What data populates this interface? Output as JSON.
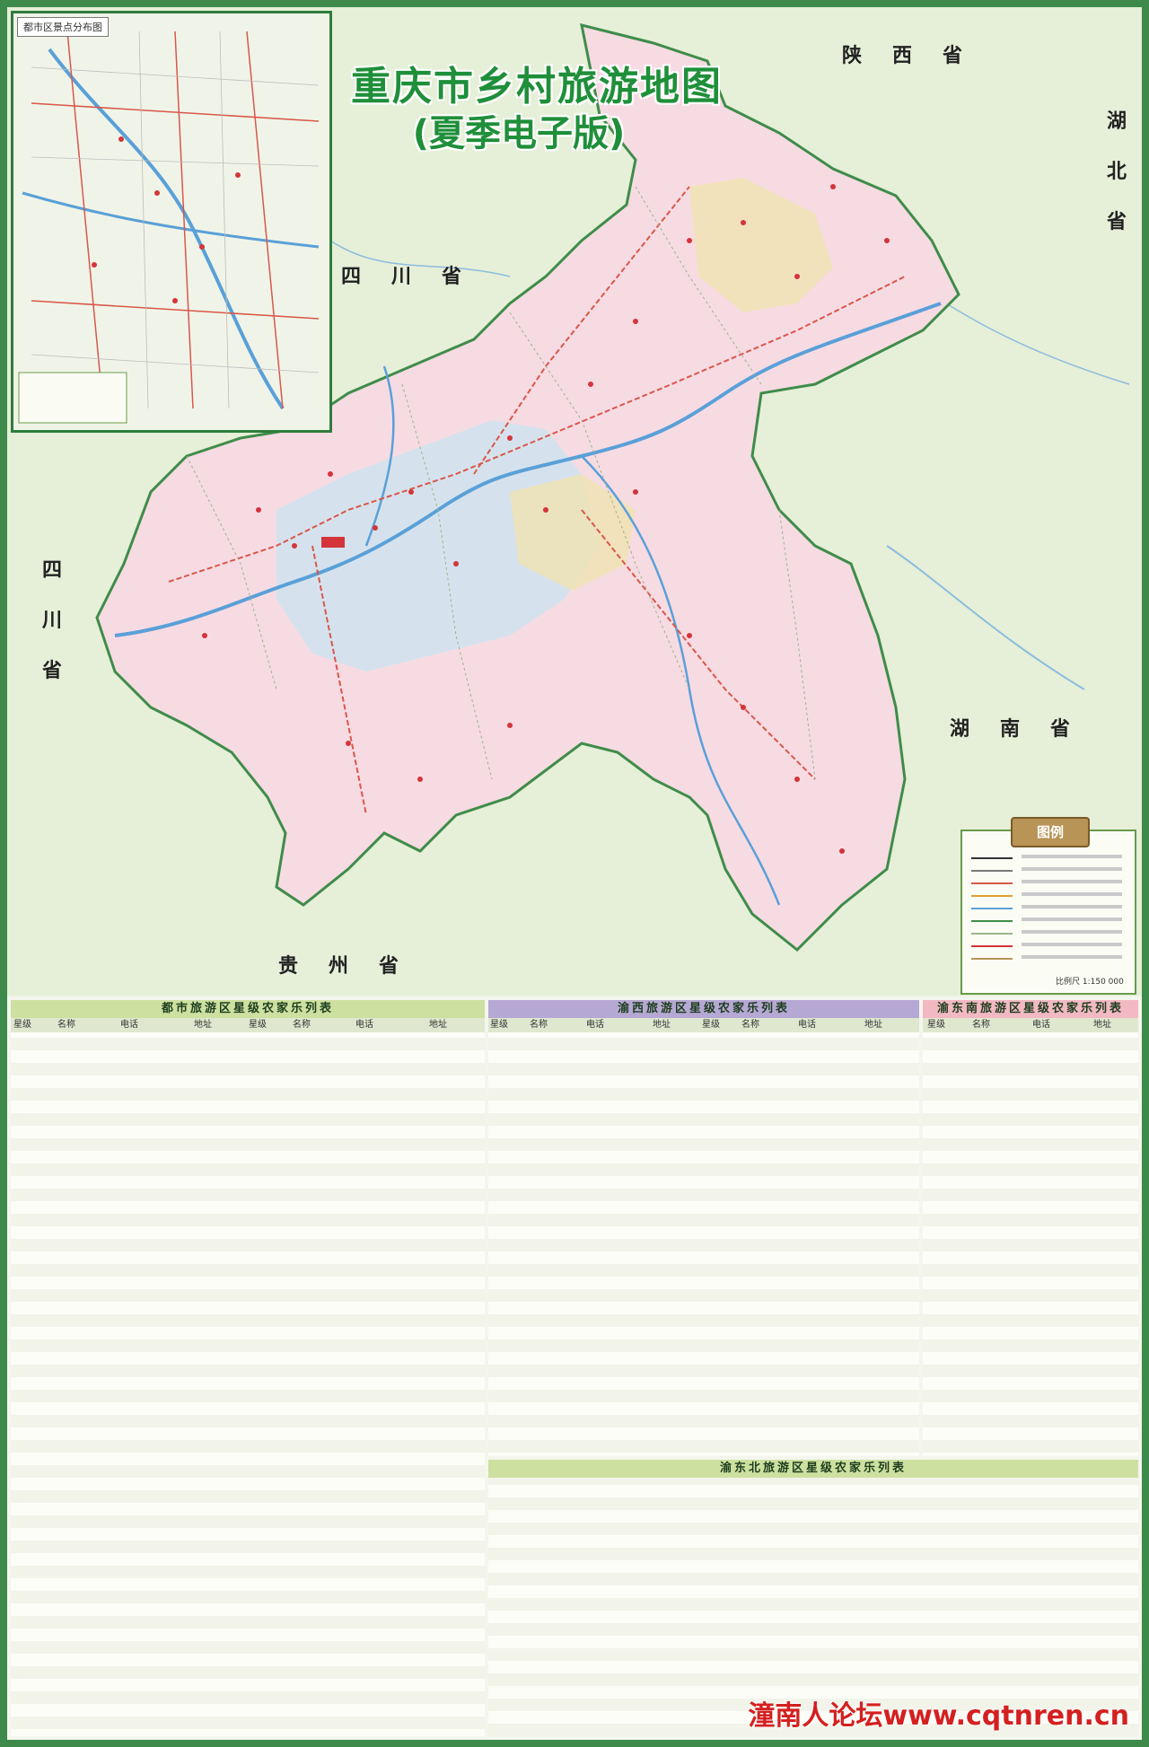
{
  "map": {
    "title": "重庆市乡村旅游地图",
    "subtitle": "(夏季电子版)",
    "inset_title": "都市区景点分布图",
    "provinces": {
      "shaanxi": "陕西省",
      "hubei": "湖北省",
      "sichuan_north": "四川省",
      "sichuan_west": "四川省",
      "hunan": "湖南省",
      "guizhou": "贵州省"
    },
    "legend_title": "图例",
    "scale": "比例尺 1:150 000",
    "region_colors": {
      "chongqing_fill": "#f7dbe3",
      "central_fill": "#cfe3ef",
      "yellow_fill": "#efe3b0",
      "outside_fill": "#e6efd8",
      "border": "#3f8c4a",
      "river": "#5aa0d8",
      "road": "#d9574a"
    }
  },
  "tables": {
    "urban": {
      "title": "都市旅游区星级农家乐列表",
      "headers": [
        "星级",
        "名称",
        "电话",
        "地址",
        "星级",
        "名称",
        "电话",
        "地址"
      ],
      "color": "#cde0a0"
    },
    "yuxi": {
      "title": "渝西旅游区星级农家乐列表",
      "headers": [
        "星级",
        "名称",
        "电话",
        "地址",
        "星级",
        "名称",
        "电话",
        "地址"
      ],
      "color": "#b6a8d4"
    },
    "yudongnan": {
      "title": "渝东南旅游区星级农家乐列表",
      "headers": [
        "星级",
        "名称",
        "电话",
        "地址"
      ],
      "color": "#f2b9c3"
    },
    "yudongbei": {
      "title": "渝东北旅游区星级农家乐列表",
      "color": "#cde0a0"
    }
  },
  "watermark": "潼南人论坛www.cqtnren.cn"
}
